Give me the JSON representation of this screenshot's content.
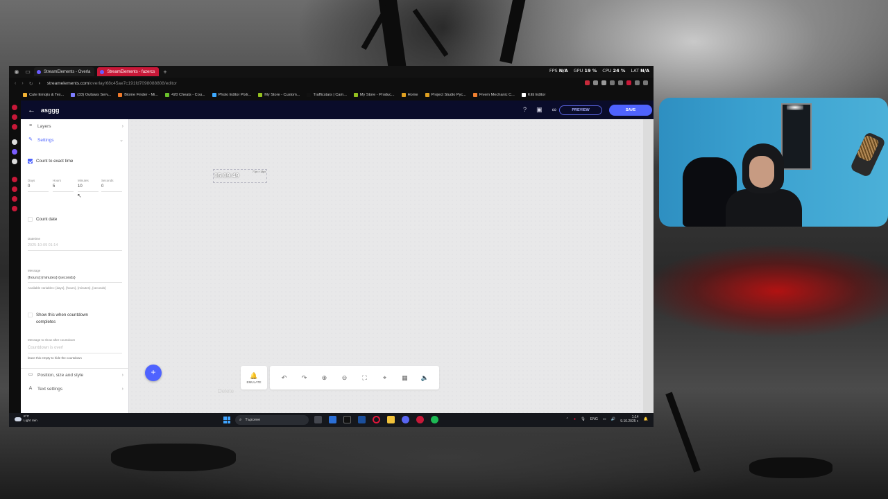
{
  "browser": {
    "tabs": [
      {
        "label": "StreamElements - Overla",
        "active": false
      },
      {
        "label": "StreamElements - fazercs",
        "active": true
      }
    ],
    "perf": {
      "fps_label": "FPS",
      "fps_value": "N/A",
      "gpu_label": "GPU",
      "gpu_value": "19 %",
      "cpu_label": "CPU",
      "cpu_value": "24 %",
      "lat_label": "LAT",
      "lat_value": "N/A"
    },
    "url_host": "streamelements.com",
    "url_path": "/overlay/68c45ae7c191fd7098088808/editor",
    "bookmarks": [
      {
        "label": "Cute Emojis & Tex...",
        "color": "#f2b233"
      },
      {
        "label": "(33) Outlaws Serv...",
        "color": "#7d7dff"
      },
      {
        "label": "Biome Finder - Mi...",
        "color": "#f07a2a"
      },
      {
        "label": "420 Cheats - Cou...",
        "color": "#6ac12b"
      },
      {
        "label": "Photo Editor Pixlr...",
        "color": "#3da9ff"
      },
      {
        "label": "My Store - Custom...",
        "color": "#94c11f"
      },
      {
        "label": "Trafficstars | Cam...",
        "color": "#111111"
      },
      {
        "label": "My Store - Produc...",
        "color": "#94c11f"
      },
      {
        "label": "Home",
        "color": "#e0a020"
      },
      {
        "label": "Project Studio Рус...",
        "color": "#e0a020"
      },
      {
        "label": "Fivem Mechanic C...",
        "color": "#f08030"
      },
      {
        "label": "Kitti Editor",
        "color": "#ffffff"
      }
    ]
  },
  "app": {
    "title": "asggg",
    "preview_label": "PREVIEW",
    "save_label": "SAVE",
    "layers_label": "Layers",
    "settings_label": "Settings",
    "count_exact_label": "Count to exact time",
    "count_exact_checked": true,
    "time_fields": [
      {
        "label": "Days",
        "value": "0"
      },
      {
        "label": "Hours",
        "value": "5"
      },
      {
        "label": "Minutes",
        "value": "10"
      },
      {
        "label": "Seconds",
        "value": "0"
      }
    ],
    "count_date_label": "Count date",
    "datetime_label": "Datetime",
    "datetime_value": "2025-10-09 01:14",
    "message_label": "Message",
    "message_value": "{hours}:{minutes}:{seconds}",
    "available_vars": "Available variables: {days}, {hours}, {minutes}, {seconds}",
    "show_complete_label": "Show this when countdown completes",
    "msg_after_label": "Message to show after countdown",
    "msg_after_placeholder": "Countdown is over!",
    "leave_empty_hint": "leave this empty to hide the countdown",
    "position_label": "Position, size and style",
    "text_settings_label": "Text settings",
    "widget_time": "05:09:49",
    "widget_dims": "77px × 18px",
    "ghost_text": "Delete",
    "emulate_label": "EMULATE"
  },
  "taskbar": {
    "weather_temp": "8°C",
    "weather_desc": "Light rain",
    "search_placeholder": "Търсене",
    "lang": "ENG",
    "time": "1:14",
    "date": "9.10.2025 г."
  }
}
